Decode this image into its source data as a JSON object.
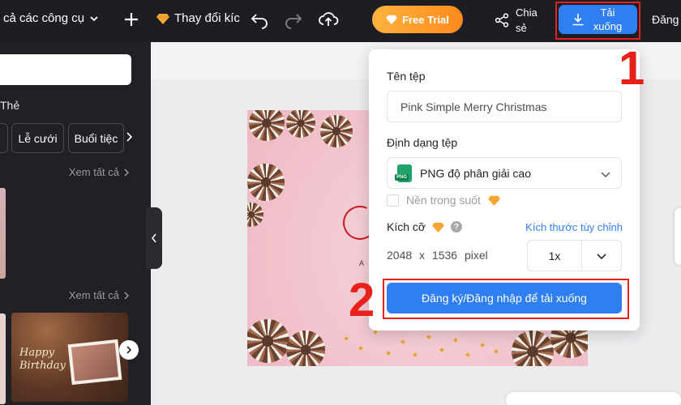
{
  "topbar": {
    "all_tools_label": "cả các công cụ",
    "resize_label": "Thay đổi kíc",
    "free_trial_label": "Free Trial",
    "share_label": "Chia sẻ",
    "download_label": "Tải xuống",
    "login_label": "Đăng"
  },
  "sidebar": {
    "category_label": "Thẻ",
    "chips": [
      "Lễ cưới",
      "Buổi tiệc"
    ],
    "see_all_1": "Xem tất cả",
    "see_all_2": "Xem tất cả",
    "thumbnail_text": "Happy Birthday"
  },
  "design": {
    "monogram_letter": "A"
  },
  "download_panel": {
    "filename_label": "Tên tệp",
    "filename_value": "Pink Simple Merry Christmas",
    "format_label": "Định dạng tệp",
    "format_value": "PNG độ phân giải cao",
    "format_icon_text": "PNG",
    "transparent_label": "Nền trong suốt",
    "size_label": "Kích cỡ",
    "custom_size_label": "Kích thước tùy chỉnh",
    "dimensions": "2048 x 1536 pixel",
    "scale_value": "1x",
    "signup_button": "Đăng ký/Đăng nhập để tải xuống"
  },
  "annotations": {
    "step_1": "1",
    "step_2": "2",
    "highlight_color": "#e8201a"
  },
  "colors": {
    "accent_blue": "#2f7ff2",
    "trial_orange": "#ff9a2a",
    "topbar_bg": "#1d1d24"
  }
}
